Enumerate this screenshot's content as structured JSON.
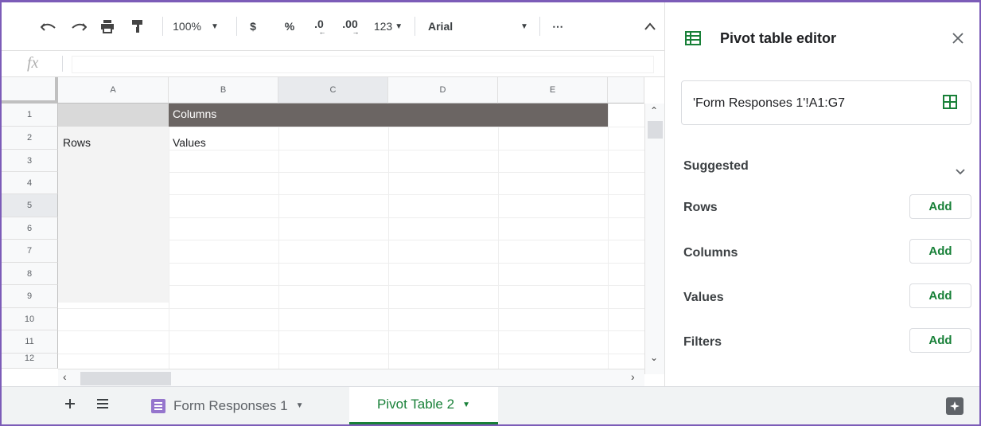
{
  "toolbar": {
    "zoom": "100%",
    "currency": "$",
    "percent": "%",
    "decrease_decimal": ".0",
    "increase_decimal": ".00",
    "more_formats": "123",
    "font": "Arial",
    "more": "⋯"
  },
  "formula_bar": {
    "fx_label": "fx"
  },
  "grid": {
    "columns": [
      "A",
      "B",
      "C",
      "D",
      "E"
    ],
    "rows": [
      "1",
      "2",
      "3",
      "4",
      "5",
      "6",
      "7",
      "8",
      "9",
      "10",
      "11",
      "12"
    ],
    "cells": {
      "B1": "Columns",
      "A2": "Rows",
      "B2": "Values"
    }
  },
  "panel": {
    "title": "Pivot table editor",
    "data_range": "'Form Responses 1'!A1:G7",
    "suggested_label": "Suggested",
    "sections": [
      {
        "label": "Rows",
        "button": "Add"
      },
      {
        "label": "Columns",
        "button": "Add"
      },
      {
        "label": "Values",
        "button": "Add"
      },
      {
        "label": "Filters",
        "button": "Add"
      }
    ]
  },
  "sheets": {
    "tabs": [
      {
        "label": "Form Responses 1",
        "active": false
      },
      {
        "label": "Pivot Table 2",
        "active": true
      }
    ]
  },
  "colors": {
    "accent_green": "#188038",
    "frame_purple": "#7c5cb8",
    "pivot_header_gray": "#6b6563",
    "pivot_rows_gray": "#f3f3f3",
    "forms_purple": "#9575cd"
  },
  "icons": [
    "undo-icon",
    "redo-icon",
    "print-icon",
    "paint-format-icon",
    "chevron-up-icon",
    "pivot-table-icon",
    "close-icon",
    "grid-select-icon",
    "chevron-down-icon",
    "add-sheet-icon",
    "all-sheets-icon",
    "forms-icon",
    "explore-icon"
  ]
}
